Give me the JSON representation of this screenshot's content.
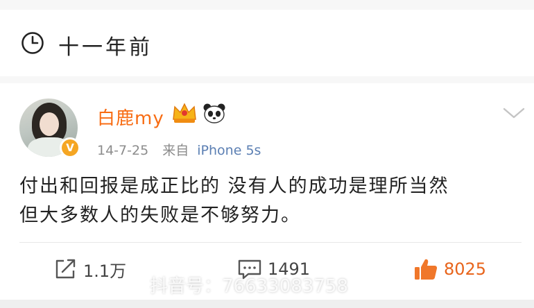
{
  "header": {
    "time_ago": "十一年前",
    "icon": "clock-icon"
  },
  "post": {
    "username": "白鹿my",
    "badges": [
      "vip-crown-icon",
      "panda-icon"
    ],
    "verified_badge": "V",
    "date": "14-7-25",
    "from_label": "来自",
    "source": "iPhone 5s",
    "text_line1": "付出和回报是成正比的 没有人的成功是理所当然",
    "text_line2": "但大多数人的失败是不够努力。"
  },
  "actions": {
    "repost_count": "1.1万",
    "comment_count": "1491",
    "like_count": "8025"
  },
  "watermark": "抖音号：76633083758",
  "colors": {
    "username": "#f86c13",
    "source_link": "#5b7fb3",
    "like": "#e8641b"
  }
}
